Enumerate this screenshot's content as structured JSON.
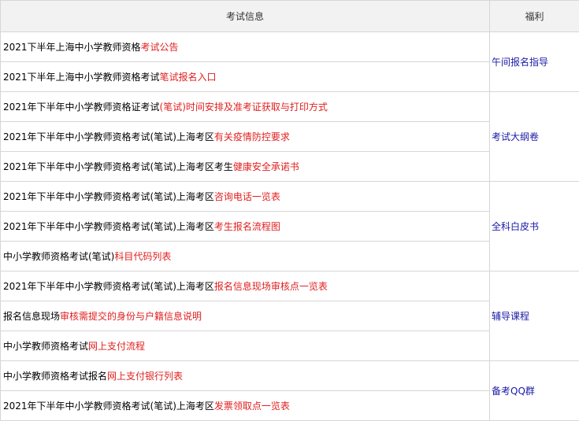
{
  "header": {
    "col1": "考试信息",
    "col2": "福利"
  },
  "rows": [
    {
      "plain": "2021下半年上海中小学教师资格",
      "link": "考试公告"
    },
    {
      "plain": "2021下半年上海中小学教师资格考试",
      "link": "笔试报名入口"
    },
    {
      "plain": "2021年下半年中小学教师资格证考试",
      "link": "(笔试)时间安排及准考证获取与打印方式"
    },
    {
      "plain": "2021年下半年中小学教师资格考试(笔试)上海考区",
      "link": "有关疫情防控要求"
    },
    {
      "plain": "2021年下半年中小学教师资格考试(笔试)上海考区考生",
      "link": "健康安全承诺书"
    },
    {
      "plain": "2021年下半年中小学教师资格考试(笔试)上海考区",
      "link": "咨询电话一览表"
    },
    {
      "plain": "2021年下半年中小学教师资格考试(笔试)上海考区",
      "link": "考生报名流程图"
    },
    {
      "plain": "中小学教师资格考试(笔试)",
      "link": "科目代码列表"
    },
    {
      "plain": "2021年下半年中小学教师资格考试(笔试)上海考区",
      "link": "报名信息现场审核点一览表"
    },
    {
      "plain": "报名信息现场",
      "link": "审核需提交的身份与户籍信息说明"
    },
    {
      "plain": "中小学教师资格考试",
      "link": "网上支付流程"
    },
    {
      "plain": "中小学教师资格考试报名",
      "link": "网上支付银行列表"
    },
    {
      "plain": "2021年下半年中小学教师资格考试(笔试)上海考区",
      "link": "发票领取点一览表"
    }
  ],
  "benefits": [
    "午间报名指导",
    "考试大纲卷",
    "全科白皮书",
    "辅导课程",
    "备考QQ群"
  ],
  "colors": {
    "link": "#e02020",
    "benefit": "#1a1aa6"
  }
}
